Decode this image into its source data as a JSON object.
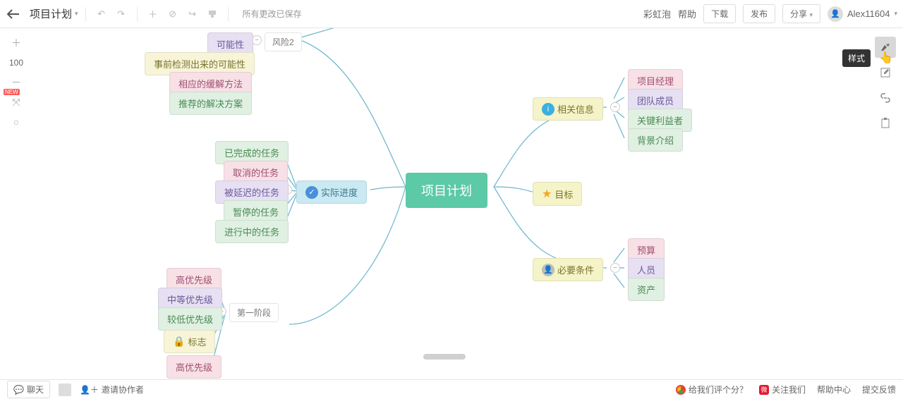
{
  "topbar": {
    "title": "项目计划",
    "save_status": "所有更改已保存",
    "rainbow": "彩虹泡",
    "help": "帮助",
    "download": "下载",
    "publish": "发布",
    "share": "分享",
    "username": "Alex11604"
  },
  "zoom": {
    "level": "100"
  },
  "right_tools": {
    "tooltip": "样式"
  },
  "mindmap": {
    "root": "项目计划",
    "related_info": {
      "label": "相关信息",
      "children": [
        "项目经理",
        "团队成员",
        "关键利益者",
        "背景介绍"
      ]
    },
    "goal": {
      "label": "目标"
    },
    "requirements": {
      "label": "必要条件",
      "children": [
        "预算",
        "人员",
        "资产"
      ]
    },
    "progress": {
      "label": "实际进度",
      "children": [
        "已完成的任务",
        "取消的任务",
        "被延迟的任务",
        "暂停的任务",
        "进行中的任务"
      ]
    },
    "risk": {
      "label": "风险2",
      "children": [
        "可能性",
        "事前检测出来的可能性",
        "相应的缓解方法",
        "推荐的解决方案"
      ]
    },
    "stage": {
      "label": "第一阶段",
      "children": [
        "高优先级",
        "中等优先级",
        "较低优先级",
        "标志",
        "高优先级"
      ]
    }
  },
  "bottombar": {
    "chat": "聊天",
    "invite": "邀请协作者",
    "rate": "给我们评个分？",
    "follow": "关注我们",
    "help_center": "帮助中心",
    "feedback": "提交反馈"
  }
}
